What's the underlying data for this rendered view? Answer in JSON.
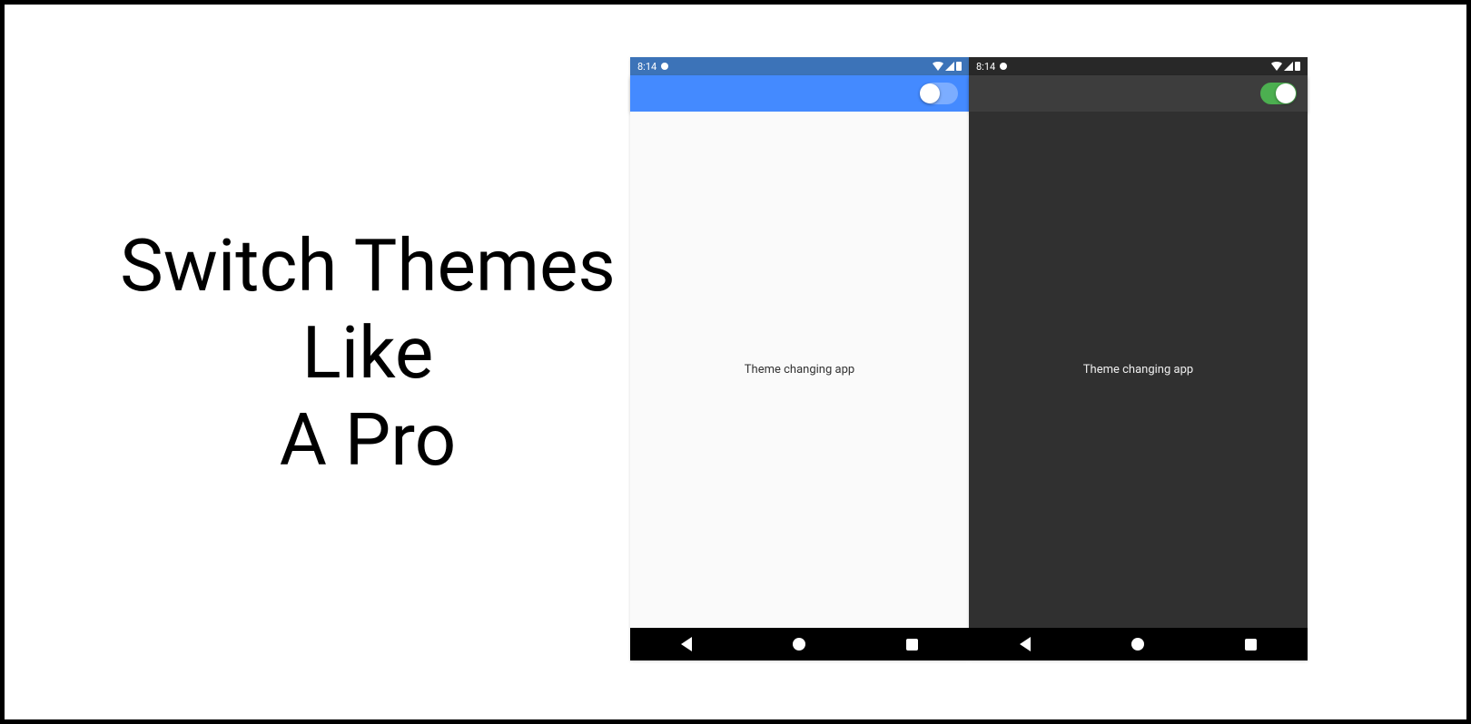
{
  "headline": {
    "line1": "Switch Themes",
    "line2": "Like",
    "line3": "A Pro"
  },
  "phones": {
    "light": {
      "status_time": "8:14",
      "app_body_text": "Theme changing app",
      "toggle_state": "off",
      "colors": {
        "status_bar": "#3c73b8",
        "app_bar": "#448aff",
        "body": "#fafafa"
      }
    },
    "dark": {
      "status_time": "8:14",
      "app_body_text": "Theme changing app",
      "toggle_state": "on",
      "colors": {
        "status_bar": "#282828",
        "app_bar": "#3d3d3d",
        "body": "#303030",
        "toggle_on": "#4caf50"
      }
    }
  }
}
